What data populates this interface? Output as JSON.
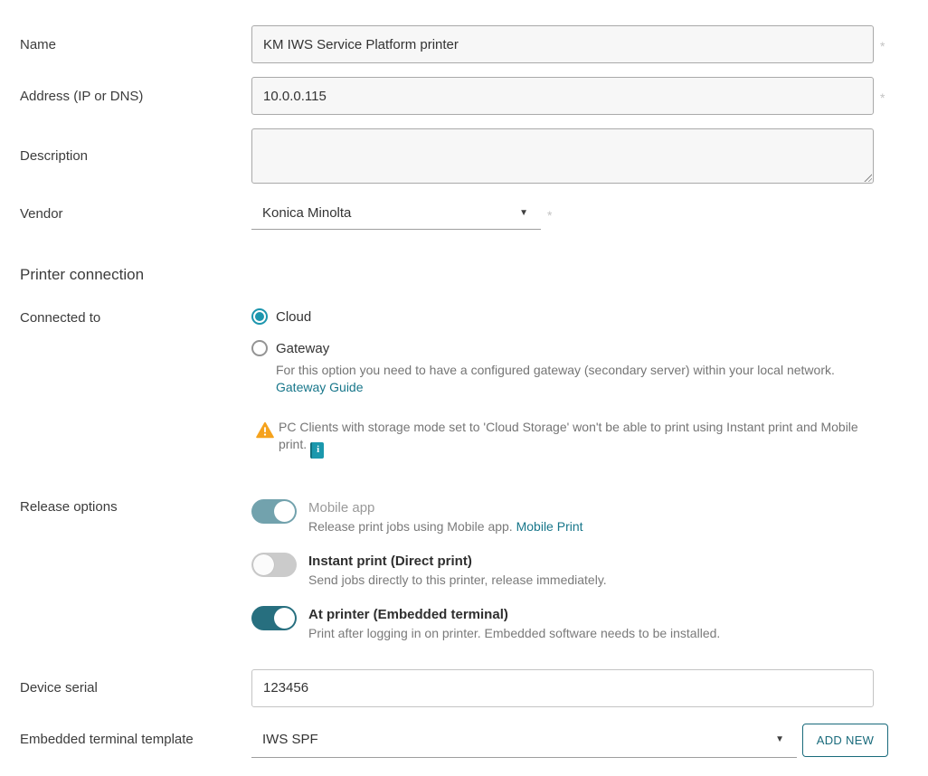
{
  "ui": {
    "required_marker": "*",
    "icons": {
      "dropdown_glyph": "▼",
      "warning_glyph": "!",
      "info_glyph": "i"
    },
    "colors": {
      "accent_teal": "#1d96ae",
      "link_teal": "#17768a",
      "toggle_on": "#276f7f",
      "toggle_on_muted": "#72a2ad",
      "toggle_off": "#cbcbcb",
      "warning_orange": "#f5a21d",
      "button_teal": "#186a7b"
    }
  },
  "fields": {
    "name": {
      "label": "Name",
      "value": "KM IWS Service Platform printer"
    },
    "address": {
      "label": "Address (IP or DNS)",
      "value": "10.0.0.115"
    },
    "description": {
      "label": "Description",
      "value": ""
    },
    "vendor": {
      "label": "Vendor",
      "value": "Konica Minolta"
    }
  },
  "printer_connection": {
    "title": "Printer connection",
    "connected_to_label": "Connected to",
    "options": [
      {
        "label": "Cloud",
        "selected": true
      },
      {
        "label": "Gateway",
        "selected": false
      }
    ],
    "gateway_help": "For this option you need to have a configured gateway (secondary server) within your local network.",
    "gateway_link": "Gateway Guide",
    "warning_text": "PC Clients with storage mode set to 'Cloud Storage' won't be able to print using Instant print and Mobile print."
  },
  "release_options": {
    "label": "Release options",
    "toggles": [
      {
        "title": "Mobile app",
        "description": "Release print jobs using Mobile app.",
        "link": "Mobile Print",
        "state": "on"
      },
      {
        "title": "Instant print (Direct print)",
        "description": "Send jobs directly to this printer, release immediately.",
        "state": "off"
      },
      {
        "title": "At printer (Embedded terminal)",
        "description": "Print after logging in on printer. Embedded software needs to be installed.",
        "state": "on"
      }
    ]
  },
  "device_serial": {
    "label": "Device serial",
    "value": "123456"
  },
  "embedded_terminal": {
    "label": "Embedded terminal template",
    "value": "IWS SPF",
    "add_button": "ADD NEW"
  }
}
